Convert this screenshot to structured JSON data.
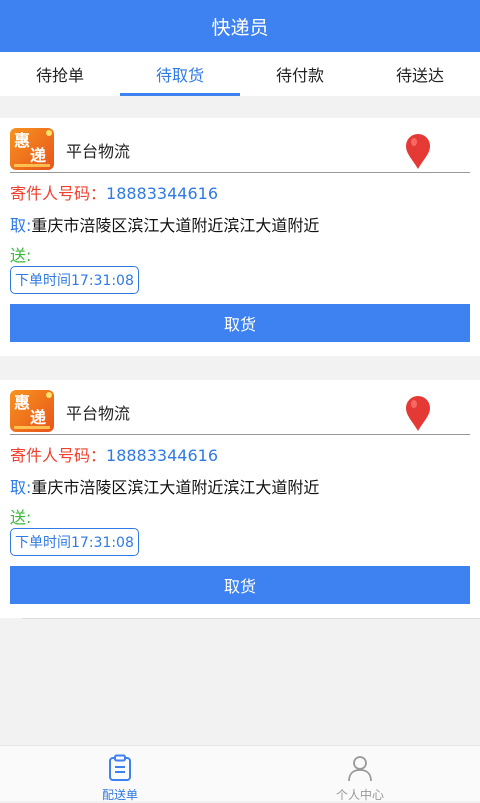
{
  "header": {
    "title": "快递员"
  },
  "tabs": [
    {
      "label": "待抢单",
      "active": false
    },
    {
      "label": "待取货",
      "active": true
    },
    {
      "label": "待付款",
      "active": false
    },
    {
      "label": "待送达",
      "active": false
    }
  ],
  "orders": [
    {
      "logo_text": [
        "惠",
        "递"
      ],
      "platform": "平台物流",
      "sender_label": "寄件人号码：",
      "sender_phone": "18883344616",
      "pickup_label": "取:",
      "pickup_address": "重庆市涪陵区滨江大道附近滨江大道附近",
      "deliver_label": "送:",
      "order_time": "下单时间17:31:08",
      "action_label": "取货"
    },
    {
      "logo_text": [
        "惠",
        "递"
      ],
      "platform": "平台物流",
      "sender_label": "寄件人号码：",
      "sender_phone": "18883344616",
      "pickup_label": "取:",
      "pickup_address": "重庆市涪陵区滨江大道附近滨江大道附近",
      "deliver_label": "送:",
      "order_time": "下单时间17:31:08",
      "action_label": "取货"
    }
  ],
  "tabbar": {
    "items": [
      {
        "label": "配送单",
        "icon": "clipboard-icon",
        "active": true
      },
      {
        "label": "个人中心",
        "icon": "user-icon",
        "active": false
      }
    ]
  },
  "colors": {
    "primary": "#3d82f0",
    "sender_label": "#f1402e",
    "deliver_label": "#3bb83b",
    "pin": "#e53935"
  }
}
